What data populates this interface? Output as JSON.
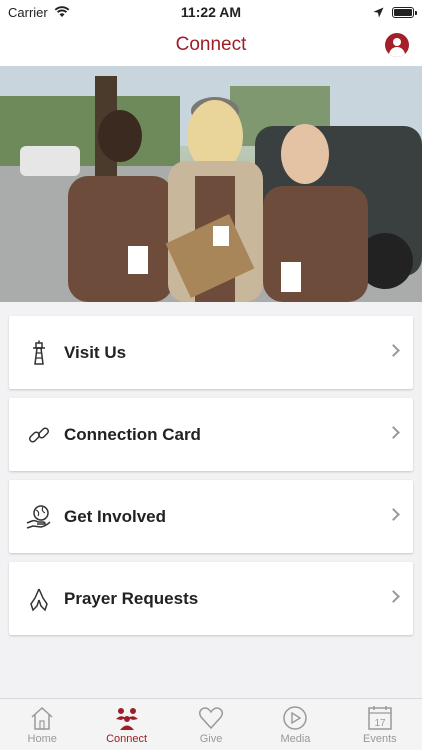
{
  "status_bar": {
    "carrier": "Carrier",
    "time": "11:22 AM",
    "wifi_icon": "wifi-icon",
    "location_icon": "location-arrow-icon",
    "battery_icon": "battery-icon",
    "battery_level": 1.0
  },
  "nav": {
    "title": "Connect",
    "profile_icon": "profile-icon"
  },
  "hero": {
    "image": "photo-three-women-volunteers"
  },
  "menu": [
    {
      "label": "Visit Us",
      "icon": "lighthouse-icon"
    },
    {
      "label": "Connection Card",
      "icon": "link-icon"
    },
    {
      "label": "Get Involved",
      "icon": "hand-globe-icon"
    },
    {
      "label": "Prayer Requests",
      "icon": "praying-hands-icon"
    }
  ],
  "tabs": [
    {
      "label": "Home",
      "icon": "home-icon",
      "active": false
    },
    {
      "label": "Connect",
      "icon": "people-icon",
      "active": true
    },
    {
      "label": "Give",
      "icon": "heart-icon",
      "active": false
    },
    {
      "label": "Media",
      "icon": "play-icon",
      "active": false
    },
    {
      "label": "Events",
      "icon": "calendar-icon",
      "active": false,
      "date": "17"
    }
  ],
  "colors": {
    "accent": "#9c1f27",
    "inactive": "#999999",
    "background": "#f2f2f4"
  }
}
